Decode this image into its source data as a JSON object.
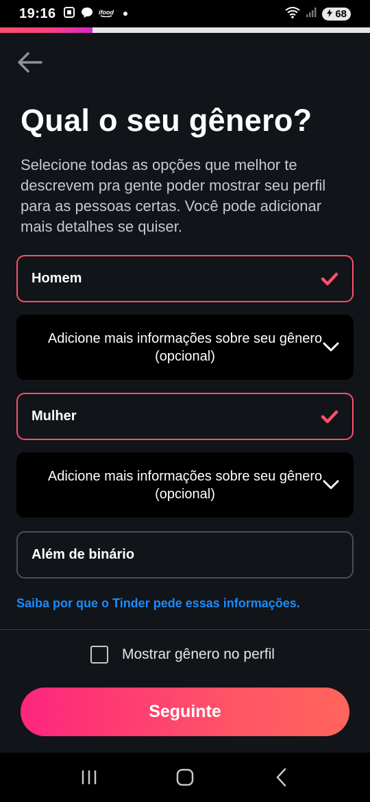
{
  "status_bar": {
    "time": "19:16",
    "notification_icons": [
      "screenshot-icon",
      "chat-icon",
      "ifood-icon"
    ],
    "battery": "68"
  },
  "progress": {
    "fraction": 0.25
  },
  "header": {
    "title": "Qual o seu gênero?",
    "subtitle": "Selecione todas as opções que melhor te descrevem pra gente poder mostrar seu perfil para as pessoas certas. Você pode adicionar mais detalhes se quiser."
  },
  "options": [
    {
      "label": "Homem",
      "selected": true
    },
    {
      "label": "Mulher",
      "selected": true
    },
    {
      "label": "Além de binário",
      "selected": false
    }
  ],
  "more_info": {
    "label": "Adicione mais informações sobre seu gênero (opcional)"
  },
  "why_link": "Saiba por que o Tinder pede essas informações.",
  "show_gender": {
    "label": "Mostrar gênero no perfil",
    "checked": false
  },
  "next_button": "Seguinte",
  "colors": {
    "background": "#111418",
    "accent": "#fd5068",
    "link": "#1a8cff",
    "button_gradient_start": "#fd267d",
    "button_gradient_end": "#ff655b"
  }
}
